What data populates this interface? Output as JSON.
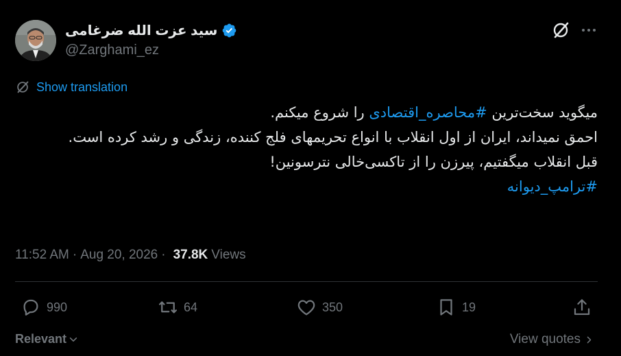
{
  "author": {
    "display_name": "سید عزت الله ضرغامی",
    "handle": "@Zarghami_ez",
    "verified_icon": "verified-badge-icon",
    "verified_color": "#1d9bf0"
  },
  "header_icons": {
    "grok": "grok-icon",
    "more": "more-icon"
  },
  "translate": {
    "label": "Show translation",
    "icon": "grok-icon"
  },
  "tweet": {
    "line1_prefix": "میگوید سخت‌ترین ",
    "line1_hashtag": "#محاصره_اقتصادی",
    "line1_suffix": " را شروع میکنم.",
    "line2": "احمق نمیداند، ایران از اول انقلاب با انواع تحریمهای فلج کننده، زندگی و رشد کرده است.",
    "line3": "قبل انقلاب میگفتیم، پیرزن را از تاکسی‌خالی نترسونین!",
    "hashtag2": "#ترامپ_دیوانه"
  },
  "meta": {
    "time": "11:52 AM",
    "separator": "·",
    "date": "Aug 20, 2026",
    "views_count": "37.8K",
    "views_label": "Views"
  },
  "actions": {
    "reply": "990",
    "repost": "64",
    "like": "350",
    "bookmark": "19"
  },
  "footer": {
    "relevant": "Relevant",
    "view_quotes": "View quotes"
  },
  "colors": {
    "accent": "#1d9bf0",
    "muted": "#71767b",
    "text": "#e7e9ea",
    "background": "#000000"
  }
}
